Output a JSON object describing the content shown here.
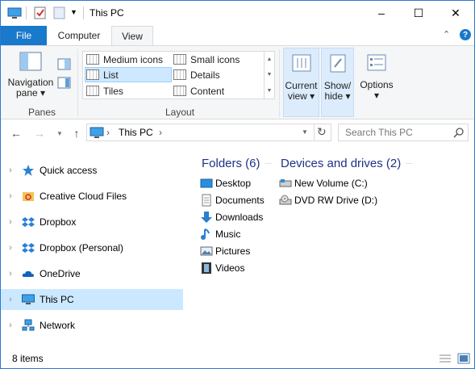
{
  "window": {
    "title": "This PC",
    "minimize": "–",
    "maximize": "☐",
    "close": "✕"
  },
  "ribbon": {
    "tabs": {
      "file": "File",
      "computer": "Computer",
      "view": "View"
    },
    "help": "?",
    "collapse": "⌃",
    "panes": {
      "nav_label_1": "Navigation",
      "nav_label_2": "pane ▾",
      "group": "Panes"
    },
    "layout": {
      "group": "Layout",
      "items": [
        "Medium icons",
        "Small icons",
        "List",
        "Details",
        "Tiles",
        "Content"
      ],
      "selected": "List"
    },
    "current_view": {
      "l1": "Current",
      "l2": "view ▾"
    },
    "show_hide": {
      "l1": "Show/",
      "l2": "hide ▾"
    },
    "options": {
      "l1": "Options",
      "l2": "▾"
    }
  },
  "address": {
    "location": "This PC",
    "sep": "›",
    "search_placeholder": "Search This PC"
  },
  "nav": {
    "items": [
      "Quick access",
      "Creative Cloud Files",
      "Dropbox",
      "Dropbox (Personal)",
      "OneDrive",
      "This PC",
      "Network"
    ],
    "selected": "This PC"
  },
  "content": {
    "folders_header": "Folders (6)",
    "drives_header": "Devices and drives (2)",
    "folders": [
      "Desktop",
      "Documents",
      "Downloads",
      "Music",
      "Pictures",
      "Videos"
    ],
    "drives": [
      "New Volume (C:)",
      "DVD RW Drive (D:)"
    ]
  },
  "status": {
    "count": "8 items"
  },
  "colors": {
    "accent": "#1979ca",
    "selection": "#cce8ff",
    "header_text": "#1e3287"
  }
}
